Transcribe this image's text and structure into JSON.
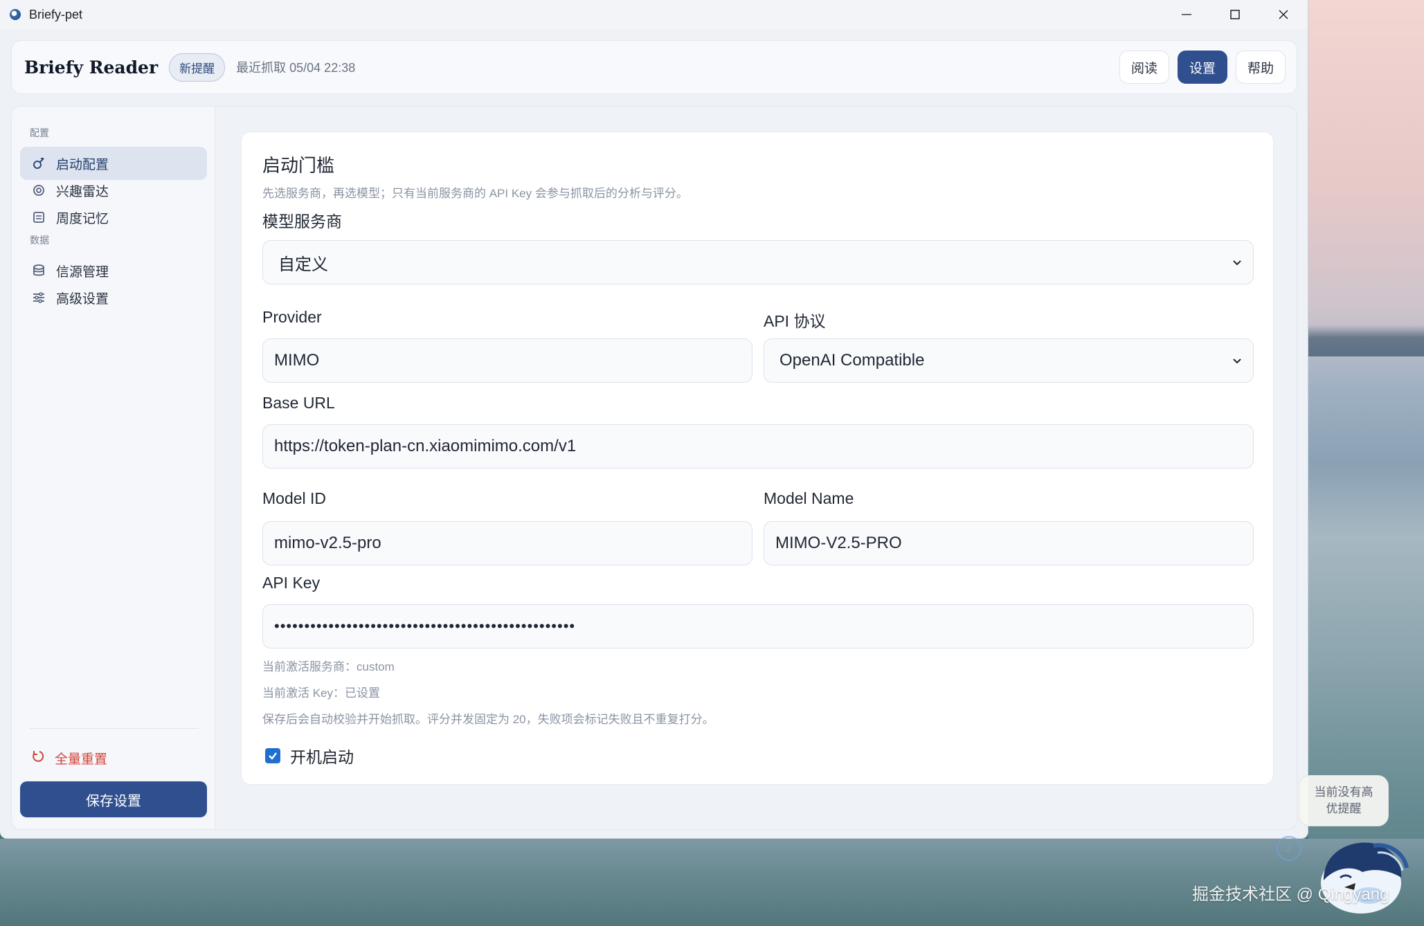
{
  "window": {
    "title": "Briefy-pet"
  },
  "header": {
    "brand": "Briefy Reader",
    "badge": "新提醒",
    "last_fetch": "最近抓取 05/04 22:38",
    "buttons": {
      "read": "阅读",
      "settings": "设置",
      "help": "帮助"
    }
  },
  "sidebar": {
    "section_config": "配置",
    "items_config": [
      {
        "label": "启动配置",
        "icon": "launch-icon",
        "active": true
      },
      {
        "label": "兴趣雷达",
        "icon": "radar-icon"
      },
      {
        "label": "周度记忆",
        "icon": "memory-icon"
      }
    ],
    "section_data": "数据",
    "items_data": [
      {
        "label": "信源管理",
        "icon": "database-icon"
      },
      {
        "label": "高级设置",
        "icon": "sliders-icon"
      }
    ],
    "reset": "全量重置",
    "save": "保存设置"
  },
  "panel": {
    "title": "启动门槛",
    "subtitle": "先选服务商，再选模型；只有当前服务商的 API Key 会参与抓取后的分析与评分。",
    "provider_service_label": "模型服务商",
    "provider_service_value": "自定义",
    "provider_label": "Provider",
    "provider_value": "MIMO",
    "protocol_label": "API 协议",
    "protocol_value": "OpenAI Compatible",
    "base_url_label": "Base URL",
    "base_url_value": "https://token-plan-cn.xiaomimimo.com/v1",
    "model_id_label": "Model ID",
    "model_id_value": "mimo-v2.5-pro",
    "model_name_label": "Model Name",
    "model_name_value": "MIMO-V2.5-PRO",
    "api_key_label": "API Key",
    "api_key_value": "••••••••••••••••••••••••••••••••••••••••••••••••••",
    "note_provider": "当前激活服务商：custom",
    "note_key": "当前激活 Key：已设置",
    "note_save": "保存后会自动校验并开始抓取。评分并发固定为 20，失败项会标记失败且不重复打分。",
    "autostart_label": "开机启动",
    "autostart_checked": true
  },
  "pet": {
    "bubble": "当前没有高优提醒",
    "ring_text": "Z"
  },
  "watermark": "掘金技术社区 @ Qingyang"
}
